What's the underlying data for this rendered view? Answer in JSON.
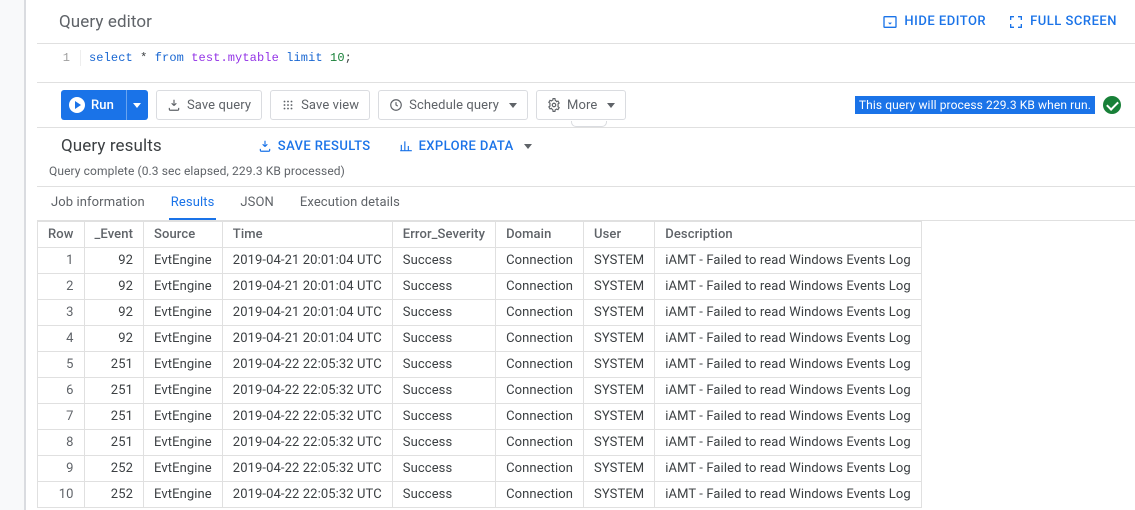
{
  "header": {
    "title": "Query editor",
    "hide_editor": "HIDE EDITOR",
    "full_screen": "FULL SCREEN"
  },
  "code": {
    "line_no": "1",
    "kw_select": "select",
    "star": " * ",
    "kw_from": "from",
    "space1": " ",
    "ident": "test.mytable",
    "space2": " ",
    "kw_limit": "limit",
    "space3": " ",
    "num": "10",
    "semi": ";"
  },
  "toolbar": {
    "run": "Run",
    "save_query": "Save query",
    "save_view": "Save view",
    "schedule": "Schedule query",
    "more": "More"
  },
  "validation": {
    "text": "This query will process 229.3 KB when run."
  },
  "results": {
    "title": "Query results",
    "save_results": "SAVE RESULTS",
    "explore_data": "EXPLORE DATA"
  },
  "status": {
    "text": "Query complete (0.3 sec elapsed, 229.3 KB processed)"
  },
  "tabs": {
    "job_info": "Job information",
    "results": "Results",
    "json": "JSON",
    "exec": "Execution details"
  },
  "table": {
    "headers": [
      "Row",
      "_Event",
      "Source",
      "Time",
      "Error_Severity",
      "Domain",
      "User",
      "Description"
    ],
    "rows": [
      [
        "1",
        "92",
        "EvtEngine",
        "2019-04-21 20:01:04 UTC",
        "Success",
        "Connection",
        "SYSTEM",
        "iAMT - Failed to read Windows Events Log"
      ],
      [
        "2",
        "92",
        "EvtEngine",
        "2019-04-21 20:01:04 UTC",
        "Success",
        "Connection",
        "SYSTEM",
        "iAMT - Failed to read Windows Events Log"
      ],
      [
        "3",
        "92",
        "EvtEngine",
        "2019-04-21 20:01:04 UTC",
        "Success",
        "Connection",
        "SYSTEM",
        "iAMT - Failed to read Windows Events Log"
      ],
      [
        "4",
        "92",
        "EvtEngine",
        "2019-04-21 20:01:04 UTC",
        "Success",
        "Connection",
        "SYSTEM",
        "iAMT - Failed to read Windows Events Log"
      ],
      [
        "5",
        "251",
        "EvtEngine",
        "2019-04-22 22:05:32 UTC",
        "Success",
        "Connection",
        "SYSTEM",
        "iAMT - Failed to read Windows Events Log"
      ],
      [
        "6",
        "251",
        "EvtEngine",
        "2019-04-22 22:05:32 UTC",
        "Success",
        "Connection",
        "SYSTEM",
        "iAMT - Failed to read Windows Events Log"
      ],
      [
        "7",
        "251",
        "EvtEngine",
        "2019-04-22 22:05:32 UTC",
        "Success",
        "Connection",
        "SYSTEM",
        "iAMT - Failed to read Windows Events Log"
      ],
      [
        "8",
        "251",
        "EvtEngine",
        "2019-04-22 22:05:32 UTC",
        "Success",
        "Connection",
        "SYSTEM",
        "iAMT - Failed to read Windows Events Log"
      ],
      [
        "9",
        "252",
        "EvtEngine",
        "2019-04-22 22:05:32 UTC",
        "Success",
        "Connection",
        "SYSTEM",
        "iAMT - Failed to read Windows Events Log"
      ],
      [
        "10",
        "252",
        "EvtEngine",
        "2019-04-22 22:05:32 UTC",
        "Success",
        "Connection",
        "SYSTEM",
        "iAMT - Failed to read Windows Events Log"
      ]
    ]
  }
}
